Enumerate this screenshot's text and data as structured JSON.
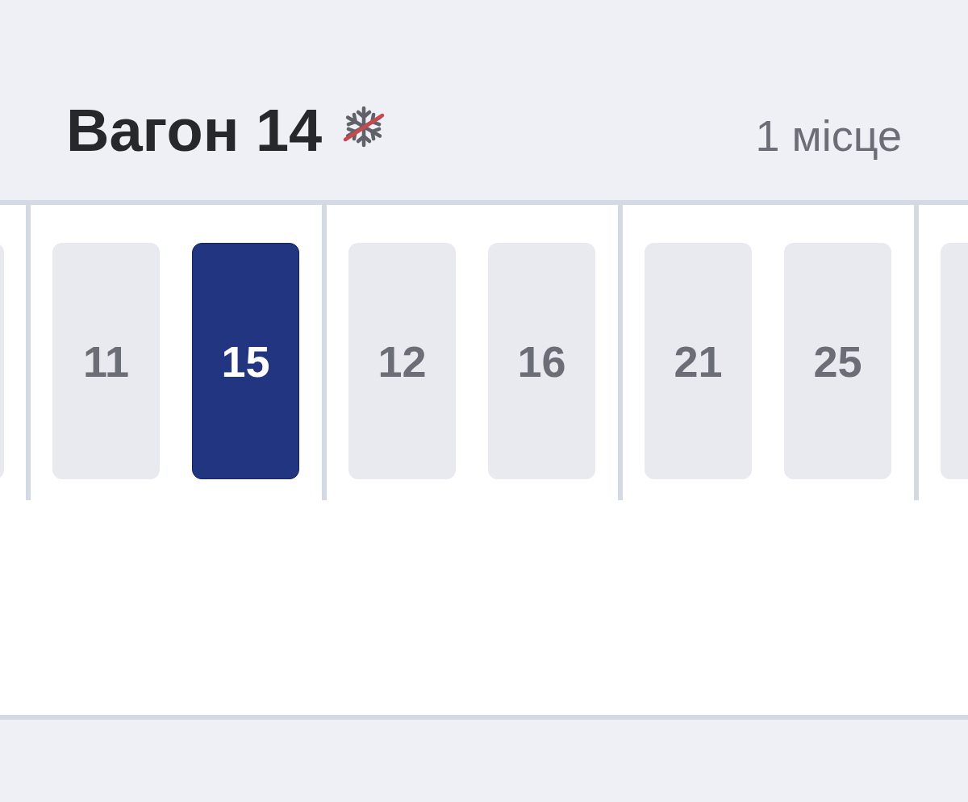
{
  "car": {
    "title": "Вагон 14",
    "air_conditioning": false,
    "seats_count": "1 місце"
  },
  "compartments": [
    {
      "seats": [
        {
          "selected": false
        }
      ]
    },
    {
      "seats": [
        {
          "number": "11",
          "selected": false
        },
        {
          "number": "15",
          "selected": true
        }
      ]
    },
    {
      "seats": [
        {
          "number": "12",
          "selected": false
        },
        {
          "number": "16",
          "selected": false
        }
      ]
    },
    {
      "seats": [
        {
          "number": "21",
          "selected": false
        },
        {
          "number": "25",
          "selected": false
        }
      ]
    },
    {
      "seats": [
        {
          "selected": false
        }
      ]
    }
  ]
}
